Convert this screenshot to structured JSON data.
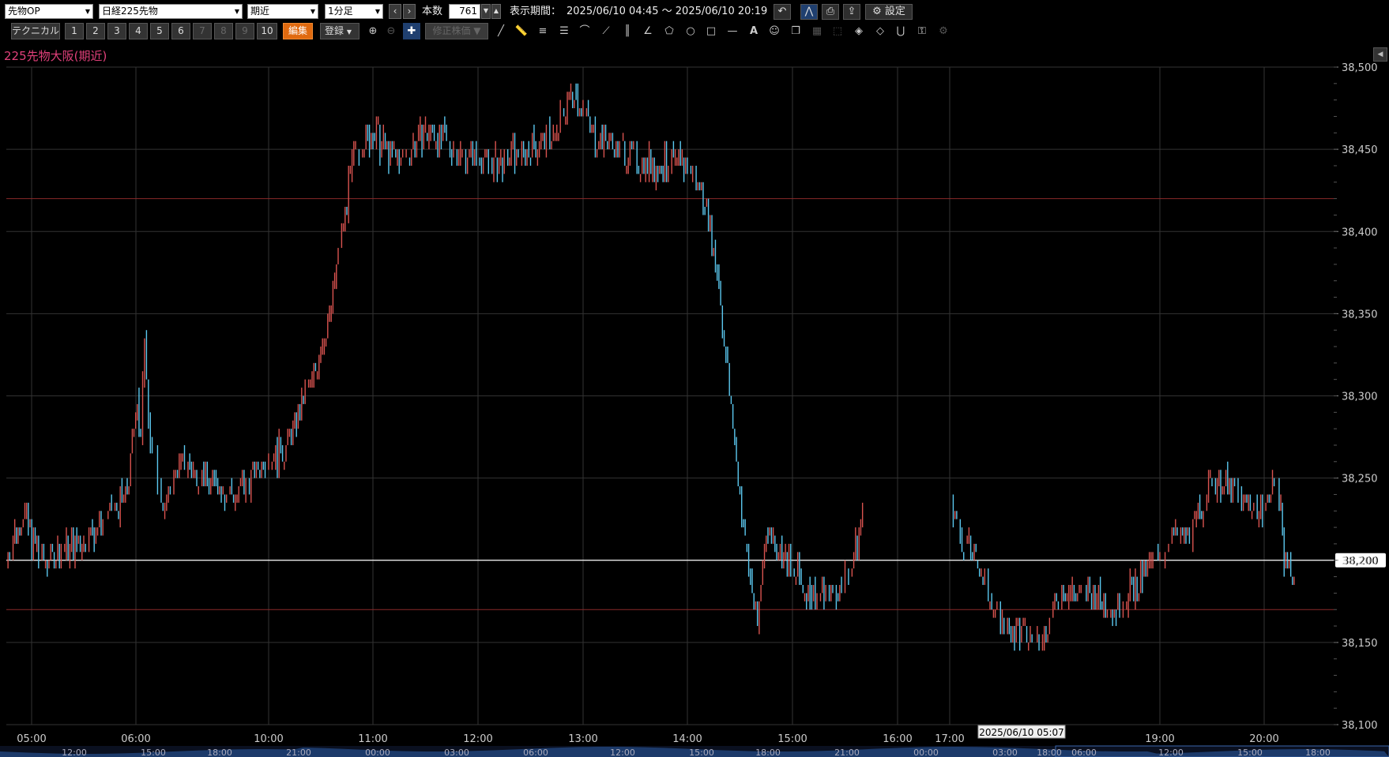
{
  "toolbar": {
    "category": "先物OP",
    "instrument": "日経225先物",
    "contract": "期近",
    "interval": "1分足",
    "count_label": "本数",
    "count_value": "761",
    "period_label": "表示期間：",
    "period_value": "2025/06/10 04:45 ～ 2025/06/10 20:19",
    "settings_label": "設定"
  },
  "toolbar2": {
    "technical_label": "テクニカル",
    "presets": [
      "1",
      "2",
      "3",
      "4",
      "5",
      "6",
      "7",
      "8",
      "9",
      "10"
    ],
    "edit_label": "編集",
    "register_label": "登録",
    "adjusted_label": "修正株価"
  },
  "chart_title": "225先物大阪(期近)",
  "colors": {
    "up": "#d9534f",
    "down": "#5bc8ef",
    "grid": "#333",
    "current": "#ffffff",
    "level": "#8a2a2a"
  },
  "chart_data": {
    "type": "candlestick",
    "title": "225先物大阪(期近)",
    "ylim": [
      38100,
      38500
    ],
    "y_ticks": [
      "38,500",
      "38,450",
      "38,400",
      "38,350",
      "38,300",
      "38,250",
      "38,200",
      "38,150",
      "38,100"
    ],
    "x_ticks": [
      "05:00",
      "06:00",
      "10:00",
      "11:00",
      "12:00",
      "13:00",
      "14:00",
      "15:00",
      "16:00",
      "17:00",
      "19:00",
      "20:00"
    ],
    "current_price": "38,200",
    "horizontal_levels": [
      38420,
      38170
    ],
    "price_path": [
      {
        "t": "04:45",
        "p": 38200
      },
      {
        "t": "04:55",
        "p": 38230
      },
      {
        "t": "05:05",
        "p": 38200
      },
      {
        "t": "05:30",
        "p": 38210
      },
      {
        "t": "05:55",
        "p": 38240
      },
      {
        "t": "06:03",
        "p": 38300
      },
      {
        "t": "06:10",
        "p": 38270
      },
      {
        "t": "06:18",
        "p": 38340
      },
      {
        "t": "06:30",
        "p": 38270
      },
      {
        "t": "06:45",
        "p": 38250
      },
      {
        "t": "07:00",
        "p": 38230
      },
      {
        "t": "07:30",
        "p": 38260
      },
      {
        "t": "09:30",
        "p": 38240
      },
      {
        "t": "09:55",
        "p": 38260
      },
      {
        "t": "10:10",
        "p": 38270
      },
      {
        "t": "10:25",
        "p": 38310
      },
      {
        "t": "10:35",
        "p": 38350
      },
      {
        "t": "10:42",
        "p": 38400
      },
      {
        "t": "10:50",
        "p": 38450
      },
      {
        "t": "11:00",
        "p": 38460
      },
      {
        "t": "11:15",
        "p": 38440
      },
      {
        "t": "11:30",
        "p": 38460
      },
      {
        "t": "11:50",
        "p": 38450
      },
      {
        "t": "12:10",
        "p": 38440
      },
      {
        "t": "12:30",
        "p": 38450
      },
      {
        "t": "12:45",
        "p": 38460
      },
      {
        "t": "12:55",
        "p": 38490
      },
      {
        "t": "13:05",
        "p": 38460
      },
      {
        "t": "13:20",
        "p": 38450
      },
      {
        "t": "13:40",
        "p": 38440
      },
      {
        "t": "14:00",
        "p": 38440
      },
      {
        "t": "14:10",
        "p": 38420
      },
      {
        "t": "14:18",
        "p": 38370
      },
      {
        "t": "14:25",
        "p": 38290
      },
      {
        "t": "14:33",
        "p": 38210
      },
      {
        "t": "14:40",
        "p": 38160
      },
      {
        "t": "14:45",
        "p": 38220
      },
      {
        "t": "14:55",
        "p": 38200
      },
      {
        "t": "15:10",
        "p": 38180
      },
      {
        "t": "15:25",
        "p": 38180
      },
      {
        "t": "15:35",
        "p": 38200
      },
      {
        "t": "15:40",
        "p": 38230
      },
      {
        "t": "17:00",
        "p": 38240
      },
      {
        "t": "17:08",
        "p": 38210
      },
      {
        "t": "17:15",
        "p": 38200
      },
      {
        "t": "17:30",
        "p": 38160
      },
      {
        "t": "17:50",
        "p": 38150
      },
      {
        "t": "18:05",
        "p": 38180
      },
      {
        "t": "18:20",
        "p": 38180
      },
      {
        "t": "18:35",
        "p": 38170
      },
      {
        "t": "18:50",
        "p": 38190
      },
      {
        "t": "19:05",
        "p": 38210
      },
      {
        "t": "19:20",
        "p": 38220
      },
      {
        "t": "19:30",
        "p": 38250
      },
      {
        "t": "19:45",
        "p": 38240
      },
      {
        "t": "20:00",
        "p": 38230
      },
      {
        "t": "20:08",
        "p": 38250
      },
      {
        "t": "20:12",
        "p": 38200
      },
      {
        "t": "20:19",
        "p": 38190
      }
    ]
  },
  "navigator": {
    "cursor_label": "2025/06/10 05:07",
    "time_labels": [
      "12:00",
      "15:00",
      "18:00",
      "21:00",
      "00:00",
      "03:00",
      "06:00",
      "12:00",
      "15:00",
      "18:00",
      "21:00",
      "00:00",
      "03:00",
      "18:00",
      "06:00",
      "12:00",
      "15:00",
      "18:00"
    ]
  }
}
